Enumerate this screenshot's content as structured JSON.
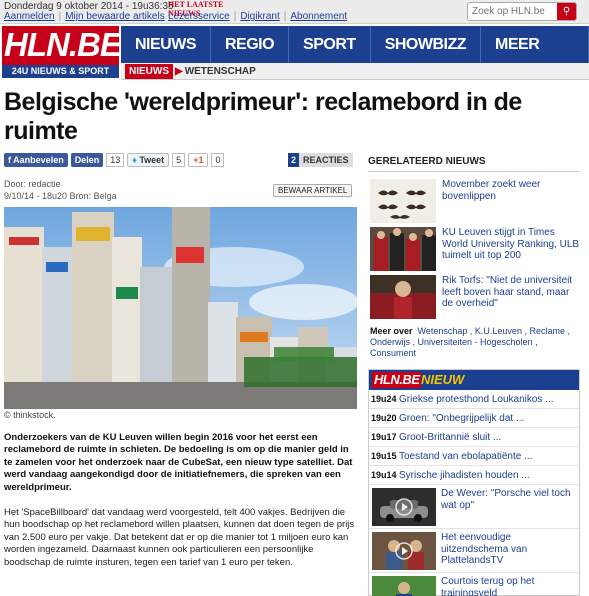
{
  "topbar": {
    "date": "Donderdag 9 oktober 2014 - 19u36:35",
    "links": [
      "Aanmelden",
      "Mijn bewaarde artikels"
    ],
    "partner": "HET LAATSTE NIEUWS",
    "partner_links": [
      "Lezersservice",
      "Digikrant",
      "Abonnement"
    ],
    "search_placeholder": "Zoek op HLN.be"
  },
  "logo": {
    "mark": "HLN.BE",
    "tagline": "24U NIEUWS & SPORT"
  },
  "nav": {
    "items": [
      "NIEUWS",
      "REGIO",
      "SPORT",
      "SHOWBIZZ",
      "MEER HLN ▾"
    ]
  },
  "breadcrumb": {
    "section": "NIEUWS",
    "subsection": "WETENSCHAP"
  },
  "article": {
    "headline": "Belgische 'wereldprimeur': reclamebord in de ruimte",
    "share": {
      "fb_label": "Aanbevelen",
      "share_label": "Delen",
      "share_count": "13",
      "tweet_label": "Tweet",
      "tweet_count": "5",
      "gplus_label": "+1",
      "gplus_count": "0"
    },
    "reactions": {
      "count": "2",
      "label": "REACTIES"
    },
    "author": "Door: redactie",
    "dateline": "9/10/14 - 18u20  Bron: Belga",
    "save_label": "BEWAAR ARTIKEL",
    "photo_credit": "© thinkstock.",
    "lead": "Onderzoekers van de KU Leuven willen begin 2016 voor het eerst een reclamebord de ruimte in schieten. De bedoeling is om op die manier geld in te zamelen voor het onderzoek naar de CubeSat, een nieuw type satelliet. Dat werd vandaag aangekondigd door de initiatiefnemers, die spreken van een wereldprimeur.",
    "body": "Het 'SpaceBillboard' dat vandaag werd voorgesteld, telt 400 vakjes. Bedrijven die hun boodschap op het reclamebord willen plaatsen, kunnen dat doen tegen de prijs van 2.500 euro per vakje. Dat betekent dat er op die manier tot 1 miljoen euro kan worden ingezameld. Daarnaast kunnen ook particulieren een persoonlijke boodschap de ruimte insturen, tegen een tarief van 1 euro per teken."
  },
  "related": {
    "heading": "GERELATEERD NIEUWS",
    "items": [
      {
        "title": "Movember zoekt weer bovenlippen"
      },
      {
        "title": "KU Leuven stijgt in Times World University Ranking, ULB tuimelt uit top 200"
      },
      {
        "title": "Rik Torfs: \"Niet de universiteit leeft boven haar stand, maar de overheid\""
      }
    ],
    "meer_over_label": "Meer over",
    "meer_over_tags": "Wetenschap , K.U.Leuven , Reclame , Onderwijs , Universiteiten - Hogescholen , Consument"
  },
  "nieuw": {
    "logo_a": "HLN.BE",
    "logo_b": "NIEUW",
    "rows": [
      {
        "time": "19u24",
        "title": "Griekse protesthond Loukanikos ..."
      },
      {
        "time": "19u20",
        "title": "Groen: \"Onbegrijpelijk dat ..."
      },
      {
        "time": "19u17",
        "title": "Groot-Brittannië sluit ..."
      },
      {
        "time": "19u15",
        "title": "Toestand van ebolapatiënte ..."
      },
      {
        "time": "19u14",
        "title": "Syrische jihadisten houden ..."
      }
    ],
    "image_items": [
      {
        "title": "De Wever: \"Porsche viel toch wat op\""
      },
      {
        "title": "Het eenvoudige uitzendschema van PlattelandsTV"
      },
      {
        "title": "Courtois terug op het trainingsveld"
      }
    ]
  },
  "colors": {
    "brand_red": "#c60018",
    "brand_blue": "#1d3f8f",
    "accent_yellow": "#f6c500"
  }
}
